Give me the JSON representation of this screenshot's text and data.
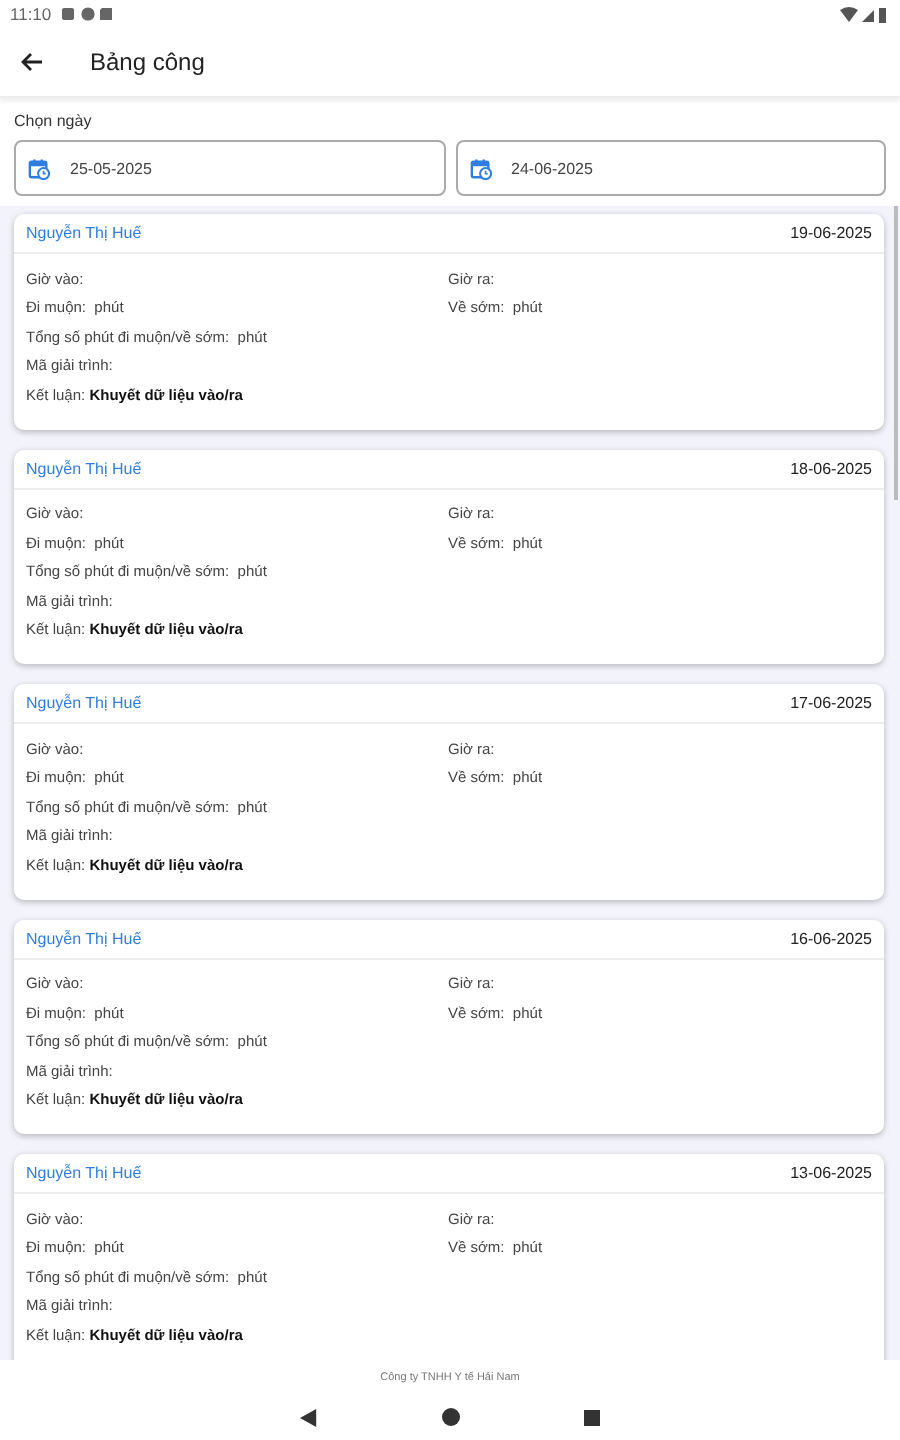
{
  "status_bar": {
    "time": "11:10"
  },
  "app_bar": {
    "title": "Bảng công"
  },
  "date_range": {
    "label": "Chọn ngày",
    "fields": [
      {
        "value": "25-05-2025"
      },
      {
        "value": "24-06-2025"
      }
    ]
  },
  "records": [
    {
      "name": "Nguyễn Thị Huế",
      "date": "19-06-2025",
      "rows": [
        [
          "Giờ vào:",
          "Giờ ra:"
        ],
        [
          "Đi muộn:  phút",
          "Về sớm:  phút"
        ],
        [
          "Tổng số phút đi muộn/về sớm:  phút"
        ],
        [
          "Mã giải trình:"
        ],
        [
          "Kết luận: **Khuyết dữ liệu vào/ra**"
        ]
      ]
    },
    {
      "name": "Nguyễn Thị Huế",
      "date": "18-06-2025",
      "rows": [
        [
          "Giờ vào:",
          "Giờ ra:"
        ],
        [
          "Đi muộn:  phút",
          "Về sớm:  phút"
        ],
        [
          "Tổng số phút đi muộn/về sớm:  phút"
        ],
        [
          "Mã giải trình:"
        ],
        [
          "Kết luận: **Khuyết dữ liệu vào/ra**"
        ]
      ]
    },
    {
      "name": "Nguyễn Thị Huế",
      "date": "17-06-2025",
      "rows": [
        [
          "Giờ vào:",
          "Giờ ra:"
        ],
        [
          "Đi muộn:  phút",
          "Về sớm:  phút"
        ],
        [
          "Tổng số phút đi muộn/về sớm:  phút"
        ],
        [
          "Mã giải trình:"
        ],
        [
          "Kết luận: **Khuyết dữ liệu vào/ra**"
        ]
      ]
    },
    {
      "name": "Nguyễn Thị Huế",
      "date": "16-06-2025",
      "rows": [
        [
          "Giờ vào:",
          "Giờ ra:"
        ],
        [
          "Đi muộn:  phút",
          "Về sớm:  phút"
        ],
        [
          "Tổng số phút đi muộn/về sớm:  phút"
        ],
        [
          "Mã giải trình:"
        ],
        [
          "Kết luận: **Khuyết dữ liệu vào/ra**"
        ]
      ]
    },
    {
      "name": "Nguyễn Thị Huế",
      "date": "13-06-2025",
      "rows": [
        [
          "Giờ vào:",
          "Giờ ra:"
        ],
        [
          "Đi muộn:  phút",
          "Về sớm:  phút"
        ],
        [
          "Tổng số phút đi muộn/về sớm:  phút"
        ],
        [
          "Mã giải trình:"
        ],
        [
          "Kết luận: **Khuyết dữ liệu vào/ra**"
        ]
      ]
    }
  ],
  "footer": {
    "text": "Công ty TNHH Y tế Hải Nam"
  }
}
